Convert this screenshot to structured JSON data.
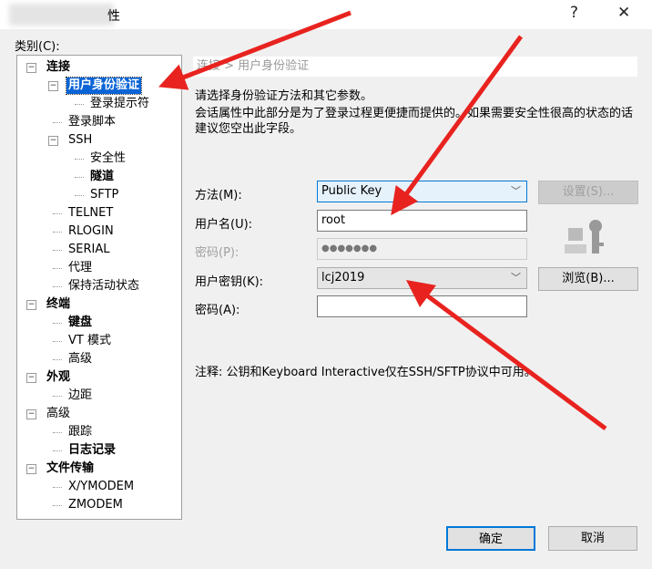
{
  "window": {
    "title": "性",
    "help": "?",
    "close": "✕"
  },
  "category_label": "类别(C):",
  "tree": [
    {
      "label": "连接",
      "level": 0,
      "bold": true,
      "expander": "⊟"
    },
    {
      "label": "用户身份验证",
      "level": 1,
      "bold": true,
      "selected": true,
      "expander": "⊟"
    },
    {
      "label": "登录提示符",
      "level": 2
    },
    {
      "label": "登录脚本",
      "level": 1
    },
    {
      "label": "SSH",
      "level": 1,
      "expander": "⊟"
    },
    {
      "label": "安全性",
      "level": 2
    },
    {
      "label": "隧道",
      "level": 2,
      "bold": true
    },
    {
      "label": "SFTP",
      "level": 2
    },
    {
      "label": "TELNET",
      "level": 1
    },
    {
      "label": "RLOGIN",
      "level": 1
    },
    {
      "label": "SERIAL",
      "level": 1
    },
    {
      "label": "代理",
      "level": 1
    },
    {
      "label": "保持活动状态",
      "level": 1
    },
    {
      "label": "终端",
      "level": 0,
      "bold": true,
      "expander": "⊟"
    },
    {
      "label": "键盘",
      "level": 1,
      "bold": true
    },
    {
      "label": "VT 模式",
      "level": 1
    },
    {
      "label": "高级",
      "level": 1
    },
    {
      "label": "外观",
      "level": 0,
      "bold": true,
      "expander": "⊟"
    },
    {
      "label": "边距",
      "level": 1
    },
    {
      "label": "高级",
      "level": 0,
      "expander": "⊟"
    },
    {
      "label": "跟踪",
      "level": 1
    },
    {
      "label": "日志记录",
      "level": 1,
      "bold": true
    },
    {
      "label": "文件传输",
      "level": 0,
      "bold": true,
      "expander": "⊟"
    },
    {
      "label": "X/YMODEM",
      "level": 1
    },
    {
      "label": "ZMODEM",
      "level": 1
    }
  ],
  "main": {
    "breadcrumb": "连接 > 用户身份验证",
    "intro": "请选择身份验证方法和其它参数。",
    "description": "会话属性中此部分是为了登录过程更便捷而提供的。如果需要安全性很高的状态的话建议您空出此字段。",
    "method_label": "方法(M):",
    "method_value": "Public Key",
    "settings_button": "设置(S)...",
    "username_label": "用户名(U):",
    "username_value": "root",
    "password_label": "密码(P):",
    "password_value": "●●●●●●●",
    "userkey_label": "用户密钥(K):",
    "userkey_value": "lcj2019",
    "browse_button": "浏览(B)...",
    "passphrase_label": "密码(A):",
    "passphrase_value": "",
    "note": "注释: 公钥和Keyboard Interactive仅在SSH/SFTP协议中可用。"
  },
  "footer": {
    "ok": "确定",
    "cancel": "取消"
  },
  "colors": {
    "selection": "#0a64d6",
    "arrow": "#e8231f"
  }
}
